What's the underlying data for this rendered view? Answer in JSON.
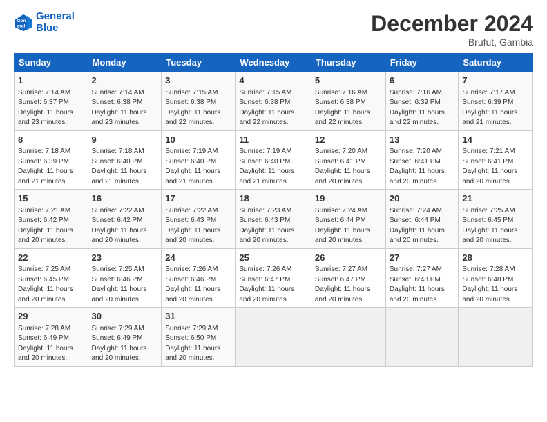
{
  "header": {
    "logo_line1": "General",
    "logo_line2": "Blue",
    "title": "December 2024",
    "subtitle": "Brufut, Gambia"
  },
  "days_of_week": [
    "Sunday",
    "Monday",
    "Tuesday",
    "Wednesday",
    "Thursday",
    "Friday",
    "Saturday"
  ],
  "weeks": [
    [
      {
        "day": "1",
        "sunrise": "Sunrise: 7:14 AM",
        "sunset": "Sunset: 6:37 PM",
        "daylight": "Daylight: 11 hours and 23 minutes."
      },
      {
        "day": "2",
        "sunrise": "Sunrise: 7:14 AM",
        "sunset": "Sunset: 6:38 PM",
        "daylight": "Daylight: 11 hours and 23 minutes."
      },
      {
        "day": "3",
        "sunrise": "Sunrise: 7:15 AM",
        "sunset": "Sunset: 6:38 PM",
        "daylight": "Daylight: 11 hours and 22 minutes."
      },
      {
        "day": "4",
        "sunrise": "Sunrise: 7:15 AM",
        "sunset": "Sunset: 6:38 PM",
        "daylight": "Daylight: 11 hours and 22 minutes."
      },
      {
        "day": "5",
        "sunrise": "Sunrise: 7:16 AM",
        "sunset": "Sunset: 6:38 PM",
        "daylight": "Daylight: 11 hours and 22 minutes."
      },
      {
        "day": "6",
        "sunrise": "Sunrise: 7:16 AM",
        "sunset": "Sunset: 6:39 PM",
        "daylight": "Daylight: 11 hours and 22 minutes."
      },
      {
        "day": "7",
        "sunrise": "Sunrise: 7:17 AM",
        "sunset": "Sunset: 6:39 PM",
        "daylight": "Daylight: 11 hours and 21 minutes."
      }
    ],
    [
      {
        "day": "8",
        "sunrise": "Sunrise: 7:18 AM",
        "sunset": "Sunset: 6:39 PM",
        "daylight": "Daylight: 11 hours and 21 minutes."
      },
      {
        "day": "9",
        "sunrise": "Sunrise: 7:18 AM",
        "sunset": "Sunset: 6:40 PM",
        "daylight": "Daylight: 11 hours and 21 minutes."
      },
      {
        "day": "10",
        "sunrise": "Sunrise: 7:19 AM",
        "sunset": "Sunset: 6:40 PM",
        "daylight": "Daylight: 11 hours and 21 minutes."
      },
      {
        "day": "11",
        "sunrise": "Sunrise: 7:19 AM",
        "sunset": "Sunset: 6:40 PM",
        "daylight": "Daylight: 11 hours and 21 minutes."
      },
      {
        "day": "12",
        "sunrise": "Sunrise: 7:20 AM",
        "sunset": "Sunset: 6:41 PM",
        "daylight": "Daylight: 11 hours and 20 minutes."
      },
      {
        "day": "13",
        "sunrise": "Sunrise: 7:20 AM",
        "sunset": "Sunset: 6:41 PM",
        "daylight": "Daylight: 11 hours and 20 minutes."
      },
      {
        "day": "14",
        "sunrise": "Sunrise: 7:21 AM",
        "sunset": "Sunset: 6:41 PM",
        "daylight": "Daylight: 11 hours and 20 minutes."
      }
    ],
    [
      {
        "day": "15",
        "sunrise": "Sunrise: 7:21 AM",
        "sunset": "Sunset: 6:42 PM",
        "daylight": "Daylight: 11 hours and 20 minutes."
      },
      {
        "day": "16",
        "sunrise": "Sunrise: 7:22 AM",
        "sunset": "Sunset: 6:42 PM",
        "daylight": "Daylight: 11 hours and 20 minutes."
      },
      {
        "day": "17",
        "sunrise": "Sunrise: 7:22 AM",
        "sunset": "Sunset: 6:43 PM",
        "daylight": "Daylight: 11 hours and 20 minutes."
      },
      {
        "day": "18",
        "sunrise": "Sunrise: 7:23 AM",
        "sunset": "Sunset: 6:43 PM",
        "daylight": "Daylight: 11 hours and 20 minutes."
      },
      {
        "day": "19",
        "sunrise": "Sunrise: 7:24 AM",
        "sunset": "Sunset: 6:44 PM",
        "daylight": "Daylight: 11 hours and 20 minutes."
      },
      {
        "day": "20",
        "sunrise": "Sunrise: 7:24 AM",
        "sunset": "Sunset: 6:44 PM",
        "daylight": "Daylight: 11 hours and 20 minutes."
      },
      {
        "day": "21",
        "sunrise": "Sunrise: 7:25 AM",
        "sunset": "Sunset: 6:45 PM",
        "daylight": "Daylight: 11 hours and 20 minutes."
      }
    ],
    [
      {
        "day": "22",
        "sunrise": "Sunrise: 7:25 AM",
        "sunset": "Sunset: 6:45 PM",
        "daylight": "Daylight: 11 hours and 20 minutes."
      },
      {
        "day": "23",
        "sunrise": "Sunrise: 7:25 AM",
        "sunset": "Sunset: 6:46 PM",
        "daylight": "Daylight: 11 hours and 20 minutes."
      },
      {
        "day": "24",
        "sunrise": "Sunrise: 7:26 AM",
        "sunset": "Sunset: 6:46 PM",
        "daylight": "Daylight: 11 hours and 20 minutes."
      },
      {
        "day": "25",
        "sunrise": "Sunrise: 7:26 AM",
        "sunset": "Sunset: 6:47 PM",
        "daylight": "Daylight: 11 hours and 20 minutes."
      },
      {
        "day": "26",
        "sunrise": "Sunrise: 7:27 AM",
        "sunset": "Sunset: 6:47 PM",
        "daylight": "Daylight: 11 hours and 20 minutes."
      },
      {
        "day": "27",
        "sunrise": "Sunrise: 7:27 AM",
        "sunset": "Sunset: 6:48 PM",
        "daylight": "Daylight: 11 hours and 20 minutes."
      },
      {
        "day": "28",
        "sunrise": "Sunrise: 7:28 AM",
        "sunset": "Sunset: 6:48 PM",
        "daylight": "Daylight: 11 hours and 20 minutes."
      }
    ],
    [
      {
        "day": "29",
        "sunrise": "Sunrise: 7:28 AM",
        "sunset": "Sunset: 6:49 PM",
        "daylight": "Daylight: 11 hours and 20 minutes."
      },
      {
        "day": "30",
        "sunrise": "Sunrise: 7:29 AM",
        "sunset": "Sunset: 6:49 PM",
        "daylight": "Daylight: 11 hours and 20 minutes."
      },
      {
        "day": "31",
        "sunrise": "Sunrise: 7:29 AM",
        "sunset": "Sunset: 6:50 PM",
        "daylight": "Daylight: 11 hours and 20 minutes."
      },
      null,
      null,
      null,
      null
    ]
  ]
}
